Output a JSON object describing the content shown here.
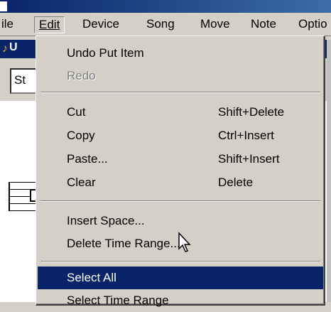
{
  "menubar": {
    "items": [
      {
        "label": "File",
        "display": "ile"
      },
      {
        "label": "Edit"
      },
      {
        "label": "Device"
      },
      {
        "label": "Song"
      },
      {
        "label": "Move"
      },
      {
        "label": "Note"
      },
      {
        "label": "Options",
        "display": "Optio"
      }
    ]
  },
  "background": {
    "st_label": "St",
    "doc_letter": "U"
  },
  "edit_menu": {
    "items": [
      {
        "label": "Undo Put Item",
        "shortcut": "",
        "enabled": true,
        "highlighted": false
      },
      {
        "label": "Redo",
        "shortcut": "",
        "enabled": false,
        "highlighted": false
      },
      {
        "label": "Cut",
        "shortcut": "Shift+Delete",
        "enabled": true,
        "highlighted": false
      },
      {
        "label": "Copy",
        "shortcut": "Ctrl+Insert",
        "enabled": true,
        "highlighted": false
      },
      {
        "label": "Paste...",
        "shortcut": "Shift+Insert",
        "enabled": true,
        "highlighted": false
      },
      {
        "label": "Clear",
        "shortcut": "Delete",
        "enabled": true,
        "highlighted": false
      },
      {
        "label": "Insert Space...",
        "shortcut": "",
        "enabled": true,
        "highlighted": false
      },
      {
        "label": "Delete Time Range...",
        "shortcut": "",
        "enabled": true,
        "highlighted": false
      },
      {
        "label": "Select All",
        "shortcut": "",
        "enabled": true,
        "highlighted": true
      },
      {
        "label": "Select Time Range",
        "shortcut": "",
        "enabled": true,
        "highlighted": false
      }
    ]
  },
  "colors": {
    "menu_face": "#d4d0c8",
    "highlight": "#0a246a",
    "disabled_text": "#808080"
  }
}
